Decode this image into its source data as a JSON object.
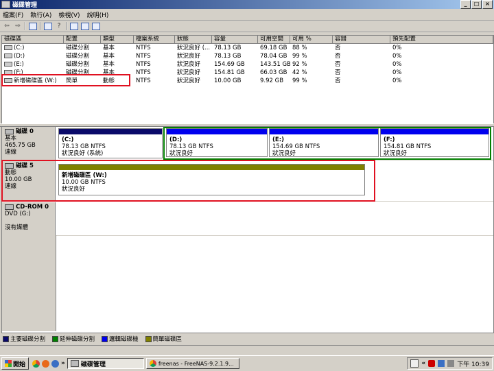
{
  "window": {
    "title": "磁碟管理"
  },
  "menu": [
    "檔案(F)",
    "執行(A)",
    "檢視(V)",
    "說明(H)"
  ],
  "toolbar_icons": [
    "back-icon",
    "forward-icon",
    "console-icon",
    "properties-icon",
    "help-icon",
    "refresh-icon",
    "export-icon",
    "settings-icon"
  ],
  "table": {
    "headers": [
      "磁碟區",
      "配置",
      "類型",
      "檔案系統",
      "狀態",
      "容量",
      "可用空間",
      "可用 %",
      "容錯",
      "預先配置"
    ],
    "rows": [
      [
        "(C:)",
        "磁碟分割",
        "基本",
        "NTFS",
        "狀況良好 (...",
        "78.13 GB",
        "69.18 GB",
        "88 %",
        "否",
        "0%"
      ],
      [
        "(D:)",
        "磁碟分割",
        "基本",
        "NTFS",
        "狀況良好",
        "78.13 GB",
        "78.04 GB",
        "99 %",
        "否",
        "0%"
      ],
      [
        "(E:)",
        "磁碟分割",
        "基本",
        "NTFS",
        "狀況良好",
        "154.69 GB",
        "143.51 GB",
        "92 %",
        "否",
        "0%"
      ],
      [
        "(F:)",
        "磁碟分割",
        "基本",
        "NTFS",
        "狀況良好",
        "154.81 GB",
        "66.03 GB",
        "42 %",
        "否",
        "0%"
      ],
      [
        "新增磁碟區 (W:)",
        "簡單",
        "動態",
        "NTFS",
        "狀況良好",
        "10.00 GB",
        "9.92 GB",
        "99 %",
        "否",
        "0%"
      ]
    ]
  },
  "disks": [
    {
      "name": "磁碟 0",
      "type": "基本",
      "size": "465.75 GB",
      "status": "連線",
      "partitions": [
        {
          "name": "(C:)",
          "size": "78.13 GB NTFS",
          "status": "狀況良好 (系統)"
        },
        {
          "name": "(D:)",
          "size": "78.13 GB NTFS",
          "status": "狀況良好"
        },
        {
          "name": "(E:)",
          "size": "154.69 GB NTFS",
          "status": "狀況良好"
        },
        {
          "name": "(F:)",
          "size": "154.81 GB NTFS",
          "status": "狀況良好"
        }
      ]
    },
    {
      "name": "磁碟 5",
      "type": "動態",
      "size": "10.00 GB",
      "status": "連線",
      "partitions": [
        {
          "name": "新增磁碟區  (W:)",
          "size": "10.00 GB NTFS",
          "status": "狀況良好"
        }
      ]
    },
    {
      "name": "CD-ROM 0",
      "type": "DVD (G:)",
      "size": "",
      "status": "沒有媒體",
      "partitions": []
    }
  ],
  "legend": [
    "主要磁碟分割",
    "延伸磁碟分割",
    "邏輯磁碟機",
    "簡單磁碟區"
  ],
  "colors": {
    "primary": "#0000a8",
    "extended": "#008000",
    "logical": "#0000ff",
    "simple": "#808000",
    "highlight": "#e01020"
  },
  "taskbar": {
    "start": "開始",
    "buttons": [
      "磁碟管理",
      "freenas - FreeNAS-9.2.1.9..."
    ],
    "clock": "下午 10:39"
  }
}
